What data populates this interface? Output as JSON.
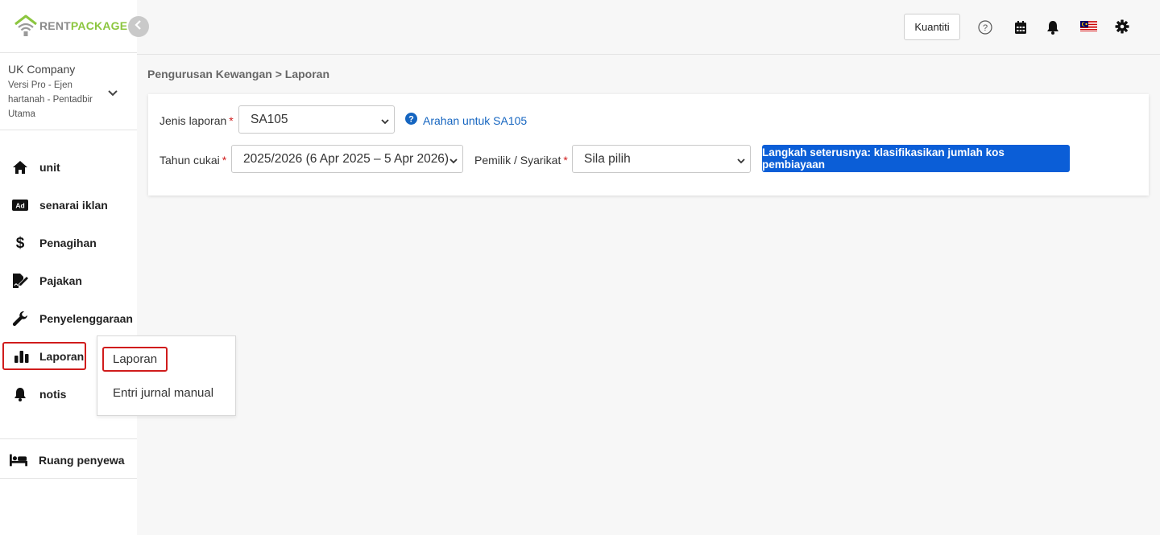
{
  "logo": {
    "part1": "RENT",
    "part2": "PACKAGE"
  },
  "company": {
    "name": "UK Company",
    "subtitle": "Versi Pro - Ejen hartanah - Pentadbir Utama"
  },
  "sidebar": {
    "items": [
      {
        "label": "unit",
        "icon": "home-icon"
      },
      {
        "label": "senarai iklan",
        "icon": "ad-icon"
      },
      {
        "label": "Penagihan",
        "icon": "dollar-icon"
      },
      {
        "label": "Pajakan",
        "icon": "signature-icon"
      },
      {
        "label": "Penyelenggaraan",
        "icon": "wrench-icon"
      },
      {
        "label": "Laporan",
        "icon": "bar-chart-icon"
      },
      {
        "label": "notis",
        "icon": "bell-icon"
      }
    ],
    "tenant_room": {
      "label": "Ruang penyewa",
      "icon": "bed-icon"
    }
  },
  "submenu": {
    "items": [
      {
        "label": "Laporan"
      },
      {
        "label": "Entri jurnal manual"
      }
    ]
  },
  "topbar": {
    "quantity_label": "Kuantiti",
    "icons": [
      "help-icon",
      "calendar-icon",
      "notification-bell-icon",
      "malaysia-flag-icon",
      "settings-gear-icon"
    ]
  },
  "breadcrumb": {
    "parent": "Pengurusan Kewangan",
    "separator": ">",
    "current": "Laporan"
  },
  "form": {
    "report_type": {
      "label": "Jenis laporan",
      "value": "SA105"
    },
    "help_link": "Arahan untuk SA105",
    "tax_year": {
      "label": "Tahun cukai",
      "value": "2025/2026 (6 Apr 2025 – 5 Apr 2026)"
    },
    "owner": {
      "label": "Pemilik / Syarikat",
      "value": "Sila pilih"
    },
    "required_mark": "*",
    "next_button": "Langkah seterusnya: klasifikasikan jumlah kos pembiayaan"
  },
  "colors": {
    "accent": "#0b5ed7",
    "brand_green": "#8cc63f",
    "highlight_red": "#d01c1c",
    "link": "#1565c0"
  }
}
